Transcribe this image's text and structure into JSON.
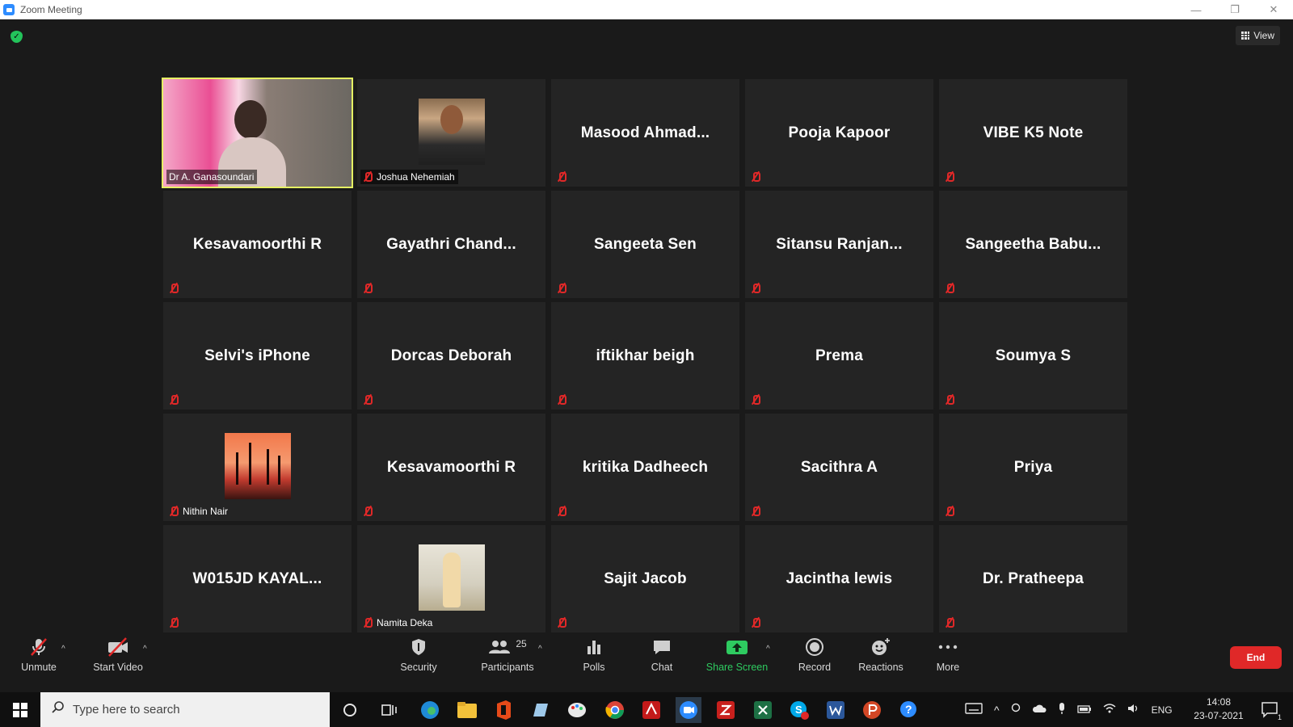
{
  "window": {
    "title": "Zoom Meeting",
    "minimize": "—",
    "restore": "❐",
    "close": "✕"
  },
  "top": {
    "view_label": "View"
  },
  "participants": [
    {
      "name": "Dr A. Ganasoundari"
    },
    {
      "name": "Joshua Nehemiah"
    },
    {
      "name": "Masood  Ahmad..."
    },
    {
      "name": "Pooja Kapoor"
    },
    {
      "name": "VIBE K5 Note"
    },
    {
      "name": "Kesavamoorthi R"
    },
    {
      "name": "Gayathri  Chand..."
    },
    {
      "name": "Sangeeta Sen"
    },
    {
      "name": "Sitansu   Ranjan..."
    },
    {
      "name": "Sangeetha  Babu..."
    },
    {
      "name": "Selvi's iPhone"
    },
    {
      "name": "Dorcas Deborah"
    },
    {
      "name": "iftikhar beigh"
    },
    {
      "name": "Prema"
    },
    {
      "name": "Soumya S"
    },
    {
      "name": "Nithin Nair"
    },
    {
      "name": "Kesavamoorthi R"
    },
    {
      "name": "kritika Dadheech"
    },
    {
      "name": "Sacithra A"
    },
    {
      "name": "Priya"
    },
    {
      "name": "W015JD  KAYAL..."
    },
    {
      "name": "Namita Deka"
    },
    {
      "name": "Sajit Jacob"
    },
    {
      "name": "Jacintha lewis"
    },
    {
      "name": "Dr. Pratheepa"
    }
  ],
  "toolbar": {
    "unmute": "Unmute",
    "start_video": "Start Video",
    "security": "Security",
    "participants": "Participants",
    "participants_count": "25",
    "polls": "Polls",
    "chat": "Chat",
    "share_screen": "Share Screen",
    "record": "Record",
    "reactions": "Reactions",
    "more": "More",
    "end": "End"
  },
  "taskbar": {
    "search_placeholder": "Type here to search",
    "lang": "ENG",
    "time": "14:08",
    "date": "23-07-2021",
    "notification_count": "1"
  },
  "colors": {
    "active_speaker": "#e5f063",
    "muted": "#e02828",
    "share": "#2ecb60",
    "end": "#e02828"
  }
}
